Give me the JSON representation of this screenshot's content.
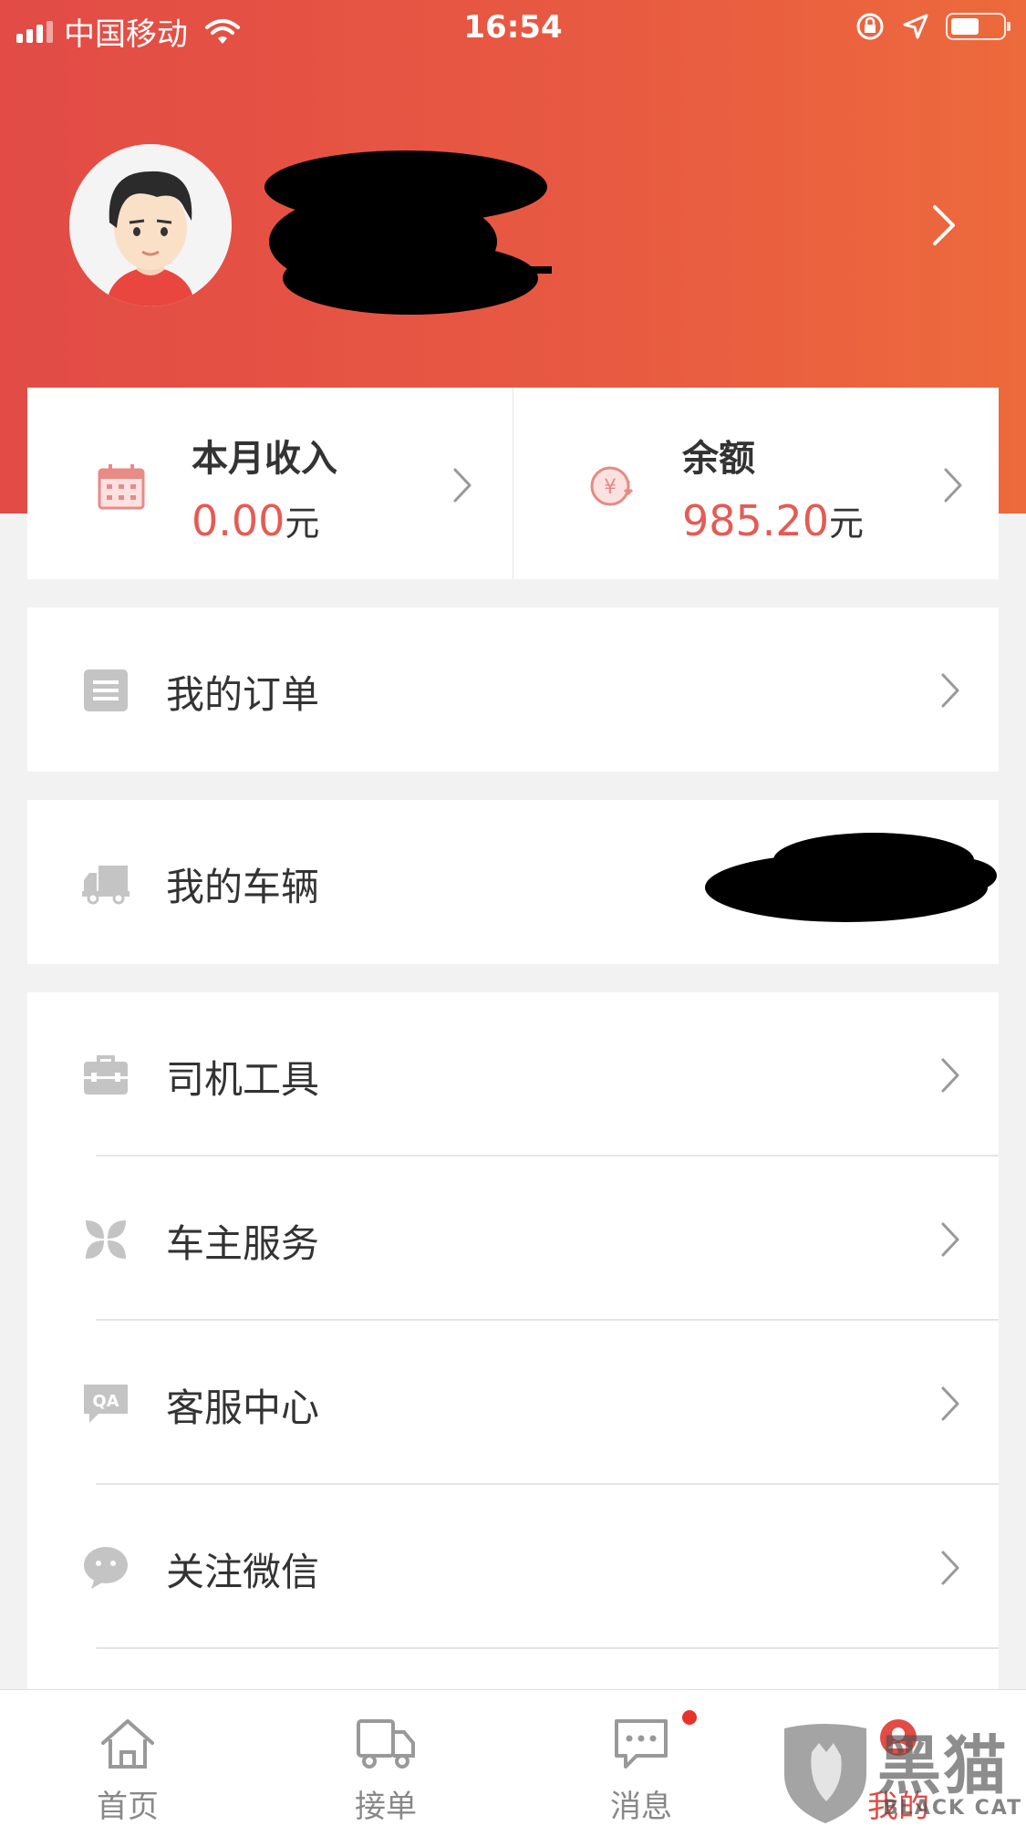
{
  "statusbar": {
    "carrier": "中国移动",
    "time": "16:54"
  },
  "profile": {
    "name": ""
  },
  "income": {
    "title": "本月收入",
    "value": "0.00",
    "unit": "元"
  },
  "balance": {
    "title": "余额",
    "value": "985.20",
    "unit": "元"
  },
  "menu": {
    "orders": "我的订单",
    "vehicle": "我的车辆",
    "tools": "司机工具",
    "services": "车主服务",
    "support": "客服中心",
    "wechat": "关注微信"
  },
  "tabs": [
    {
      "label": "首页",
      "icon": "home-icon"
    },
    {
      "label": "接单",
      "icon": "truck-icon"
    },
    {
      "label": "消息",
      "icon": "message-icon"
    },
    {
      "label": "我的",
      "icon": "user-icon"
    }
  ],
  "watermark": {
    "text": "黑猫",
    "sub": "BLACK CAT"
  },
  "colors": {
    "accent": "#e24b46",
    "value": "#e55b55"
  }
}
